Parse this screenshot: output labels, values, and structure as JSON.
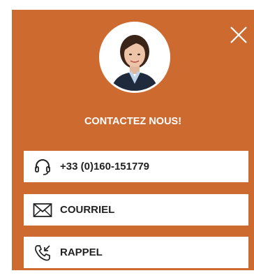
{
  "widget": {
    "heading": "CONTACTEZ NOUS!",
    "background_color": "#cd6a30",
    "close_icon": "close-icon",
    "avatar_icon": "avatar"
  },
  "buttons": [
    {
      "label": "+33 (0)160-151779",
      "icon": "headset-icon"
    },
    {
      "label": "COURRIEL",
      "icon": "envelope-icon"
    },
    {
      "label": "RAPPEL",
      "icon": "callback-phone-icon"
    }
  ]
}
